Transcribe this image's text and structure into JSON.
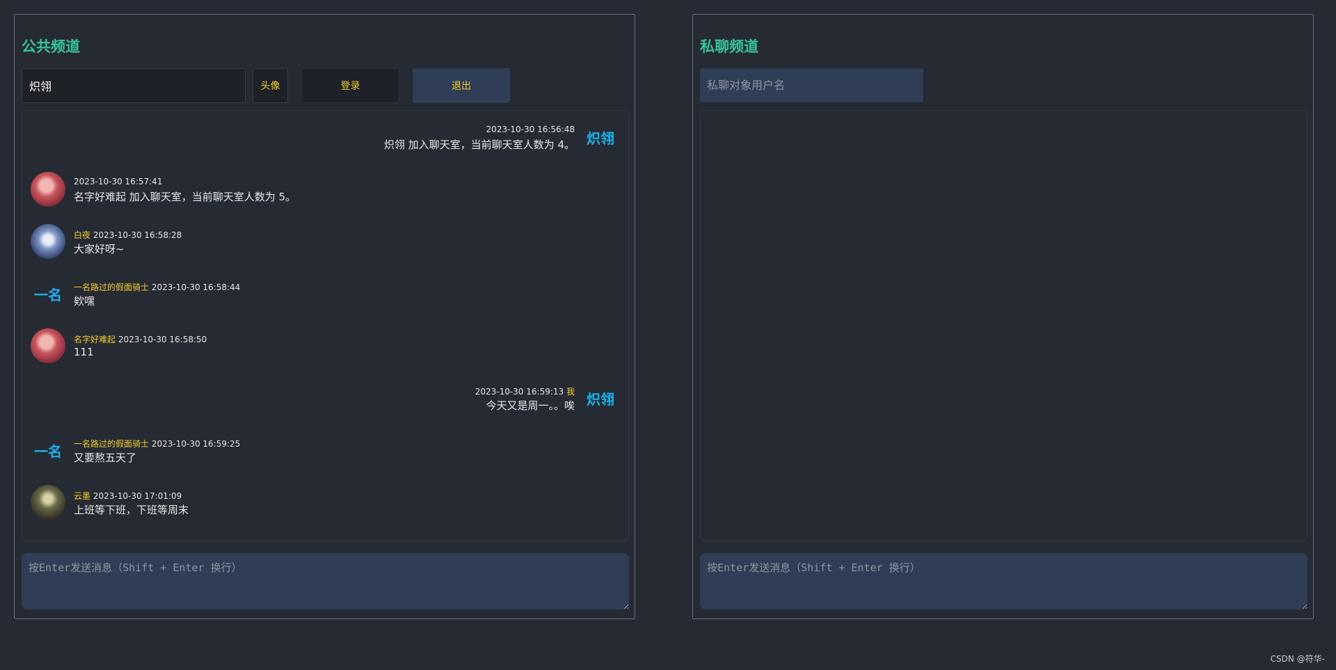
{
  "public": {
    "title": "公共频道",
    "username_value": "炽翎",
    "avatar_button": "头像",
    "login_button": "登录",
    "logout_button": "退出",
    "composer_placeholder": "按Enter发送消息（Shift + Enter 换行）",
    "messages": [
      {
        "side": "right",
        "avatar_text": "炽翎",
        "avatar_icon": "text-avatar",
        "time": "2023-10-30 16:56:48",
        "text": "炽翎 加入聊天室，当前聊天室人数为 4。"
      },
      {
        "side": "left",
        "avatar_icon": "anime-girl-red-hair-avatar",
        "time": "2023-10-30 16:57:41",
        "text": "名字好难起 加入聊天室，当前聊天室人数为 5。"
      },
      {
        "side": "left",
        "avatar_icon": "anime-boy-blue-hair-avatar",
        "name": "白夜",
        "time": "2023-10-30 16:58:28",
        "text": "大家好呀~"
      },
      {
        "side": "left",
        "avatar_text": "一名",
        "avatar_icon": "text-avatar",
        "name": "一名路过的假面骑士",
        "time": "2023-10-30 16:58:44",
        "text": "欸嘿"
      },
      {
        "side": "left",
        "avatar_icon": "anime-girl-red-hair-avatar",
        "name": "名字好难起",
        "time": "2023-10-30 16:58:50",
        "text": "111"
      },
      {
        "side": "right",
        "avatar_text": "炽翎",
        "avatar_icon": "text-avatar",
        "name": "我",
        "time": "2023-10-30 16:59:13",
        "text": "今天又是周一。。唉"
      },
      {
        "side": "left",
        "avatar_text": "一名",
        "avatar_icon": "text-avatar",
        "name": "一名路过的假面骑士",
        "time": "2023-10-30 16:59:25",
        "text": "又要熬五天了"
      },
      {
        "side": "left",
        "avatar_icon": "dark-haired-character-avatar",
        "name": "云墨",
        "time": "2023-10-30 17:01:09",
        "text": "上班等下班，下班等周末"
      }
    ]
  },
  "private": {
    "title": "私聊频道",
    "target_placeholder": "私聊对象用户名",
    "composer_placeholder": "按Enter发送消息（Shift + Enter 换行）"
  },
  "footer": {
    "credit": "CSDN @符华-"
  },
  "colors": {
    "background": "#262a33",
    "title": "#36c49a",
    "accent_yellow": "#f4cd2e",
    "avatar_text": "#1ab2ee",
    "input_blue": "#2f3d56"
  }
}
